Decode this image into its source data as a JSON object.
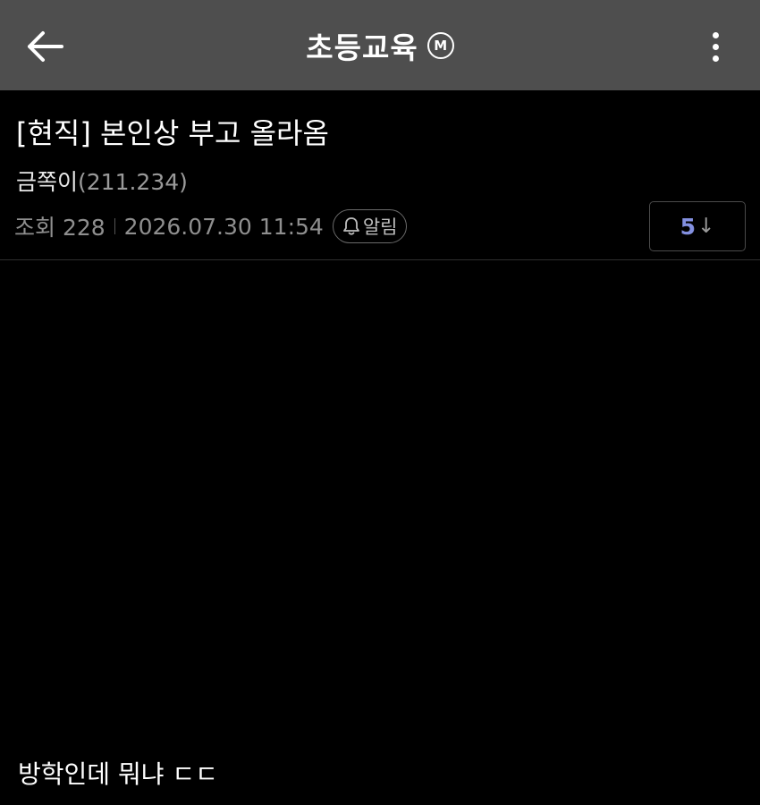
{
  "header": {
    "title": "초등교육",
    "badge": "M",
    "back_icon": "arrow-left-icon",
    "more_icon": "more-vertical-icon"
  },
  "post": {
    "title": "[현직] 본인상 부고 올라옴",
    "author_name": "금쪽이",
    "author_ip": "(211.234)",
    "views_label": "조회 228",
    "datetime": "2026.07.30 11:54",
    "alarm_label": "알림",
    "alarm_icon": "bell-icon",
    "comment_count": "5",
    "comment_arrow": "↓",
    "body": "방학인데 뭐냐 ㄷㄷ"
  },
  "colors": {
    "header_bg": "#4e4e4e",
    "page_bg": "#000000",
    "comment_count": "#8390e0"
  }
}
